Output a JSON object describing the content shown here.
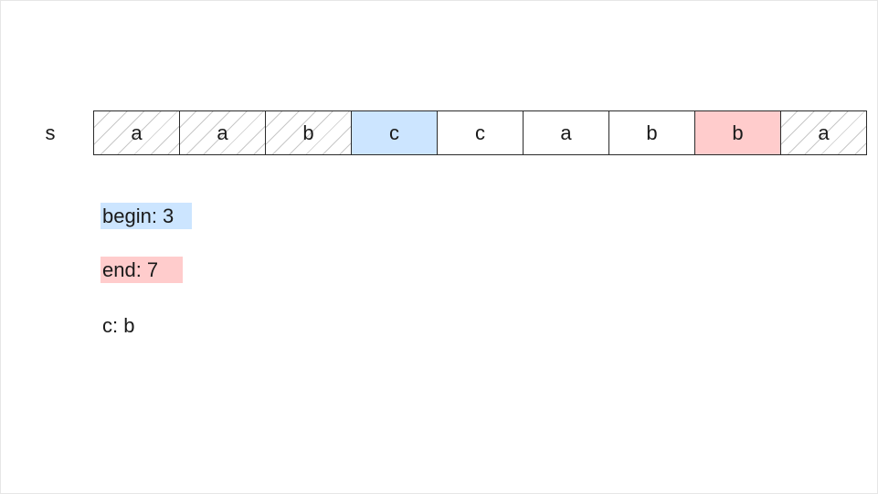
{
  "string_label": "s",
  "cells": [
    {
      "char": "a",
      "state": "hatched"
    },
    {
      "char": "a",
      "state": "hatched"
    },
    {
      "char": "b",
      "state": "hatched"
    },
    {
      "char": "c",
      "state": "begin"
    },
    {
      "char": "c",
      "state": "plain"
    },
    {
      "char": "a",
      "state": "plain"
    },
    {
      "char": "b",
      "state": "plain"
    },
    {
      "char": "b",
      "state": "end"
    },
    {
      "char": "a",
      "state": "hatched"
    }
  ],
  "variables": {
    "begin": "begin: 3",
    "end": "end: 7",
    "c": "c: b"
  },
  "colors": {
    "begin": "#cce5ff",
    "end": "#ffcccc",
    "border": "#2b2b2b",
    "hatch": "#c8c8c8"
  }
}
